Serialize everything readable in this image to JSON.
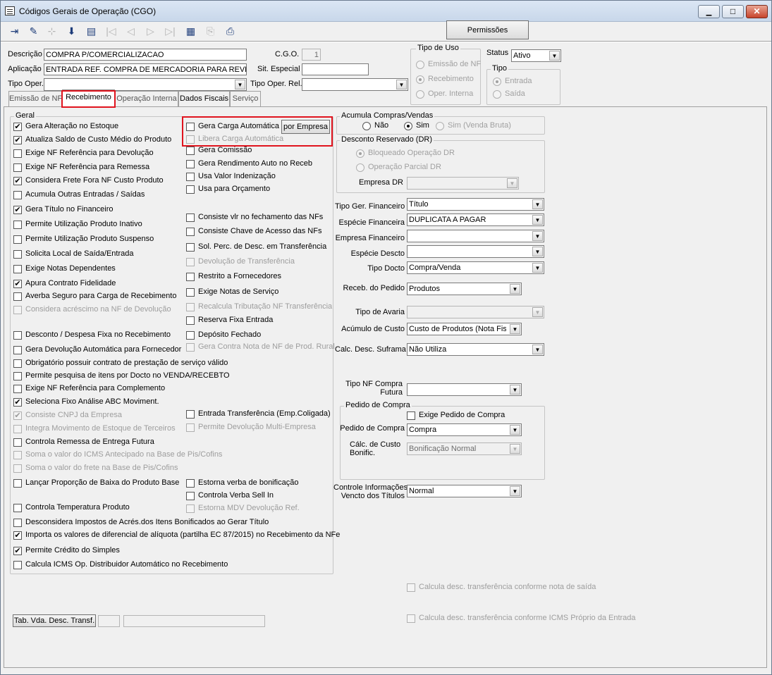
{
  "window": {
    "title": "Códigos Gerais de Operação (CGO)",
    "min": "▭",
    "max": "□",
    "close": "✕"
  },
  "toolbar": {
    "permissoes": "Permissões"
  },
  "header": {
    "descricao_label": "Descrição",
    "descricao_value": "COMPRA P/COMERCIALIZACAO",
    "aplicacao_label": "Aplicação",
    "aplicacao_value": "ENTRADA REF. COMPRA DE MERCADORIA PARA REVE",
    "tipo_oper_label": "Tipo Oper.",
    "tipo_oper_value": "",
    "cgo_label": "C.G.O.",
    "cgo_value": "1",
    "sit_especial_label": "Sit. Especial",
    "sit_especial_value": "",
    "tipo_oper_rel_label": "Tipo Oper. Rel.",
    "tipo_oper_rel_value": "",
    "tipo_uso_title": "Tipo de Uso",
    "tipo_uso_options": [
      "Emissão de NF",
      "Recebimento",
      "Oper. Interna"
    ],
    "status_label": "Status",
    "status_value": "Ativo",
    "tipo_title": "Tipo",
    "tipo_options": [
      "Entrada",
      "Saída"
    ]
  },
  "tabs": [
    "Emissão de NF",
    "Recebimento",
    "Operação Interna",
    "Dados Fiscais",
    "Serviço"
  ],
  "geral": {
    "title": "Geral",
    "left": [
      {
        "label": "Gera Alteração no Estoque",
        "checked": true,
        "disabled": false
      },
      {
        "label": "Atualiza Saldo de Custo Médio do Produto",
        "checked": true,
        "disabled": false
      },
      {
        "label": "Exige NF Referência para Devolução",
        "checked": false,
        "disabled": false
      },
      {
        "label": "Exige NF Referência para Remessa",
        "checked": false,
        "disabled": false
      },
      {
        "label": "Considera Frete Fora NF Custo Produto",
        "checked": true,
        "disabled": false
      },
      {
        "label": "Acumula Outras Entradas / Saídas",
        "checked": false,
        "disabled": false
      },
      {
        "label": "Gera Título no Financeiro",
        "checked": true,
        "disabled": false
      },
      {
        "label": "Permite Utilização Produto Inativo",
        "checked": false,
        "disabled": false
      },
      {
        "label": "Permite Utilização Produto Suspenso",
        "checked": false,
        "disabled": false
      },
      {
        "label": "Solicita Local de Saída/Entrada",
        "checked": false,
        "disabled": false
      },
      {
        "label": "Exige Notas Dependentes",
        "checked": false,
        "disabled": false
      },
      {
        "label": "Apura Contrato Fidelidade",
        "checked": true,
        "disabled": false
      },
      {
        "label": "Averba Seguro para Carga de Recebimento",
        "checked": false,
        "disabled": false
      },
      {
        "label": "Considera acréscimo na NF de Devolução",
        "checked": false,
        "disabled": true
      },
      {
        "label": "Desconto / Despesa Fixa no Recebimento",
        "checked": false,
        "disabled": false
      },
      {
        "label": "Gera Devolução Automática para Fornecedor",
        "checked": false,
        "disabled": false
      },
      {
        "label": "Obrigatório possuir contrato de prestação de serviço válido",
        "checked": false,
        "disabled": false
      },
      {
        "label": "Permite pesquisa de itens por Docto no VENDA/RECEBTO",
        "checked": false,
        "disabled": false
      },
      {
        "label": "Exige NF Referência para Complemento",
        "checked": false,
        "disabled": false
      },
      {
        "label": "Seleciona Fixo Análise ABC Moviment.",
        "checked": true,
        "disabled": false
      },
      {
        "label": "Consiste CNPJ da Empresa",
        "checked": true,
        "disabled": true
      },
      {
        "label": "Integra Movimento de Estoque de Terceiros",
        "checked": false,
        "disabled": true
      },
      {
        "label": "Controla Remessa de Entrega Futura",
        "checked": false,
        "disabled": false
      },
      {
        "label": "Soma o valor do ICMS Antecipado na Base de Pis/Cofins",
        "checked": false,
        "disabled": true
      },
      {
        "label": "Soma o valor do frete na Base de Pis/Cofins",
        "checked": false,
        "disabled": true
      },
      {
        "label": "Lançar Proporção de Baixa do Produto Base",
        "checked": false,
        "disabled": false
      },
      {
        "label": "Controla Temperatura Produto",
        "checked": false,
        "disabled": false
      },
      {
        "label": "Desconsidera Impostos de Acrés.dos Itens Bonificados ao Gerar Título",
        "checked": false,
        "disabled": false
      },
      {
        "label": "Importa os valores de diferencial de alíquota (partilha EC 87/2015) no Recebimento da NFe",
        "checked": true,
        "disabled": false
      },
      {
        "label": "Permite Crédito do Simples",
        "checked": true,
        "disabled": false
      },
      {
        "label": "Calcula ICMS Op. Distribuidor Automático no Recebimento",
        "checked": false,
        "disabled": false
      }
    ],
    "right": [
      {
        "label": "Gera Carga Automática",
        "checked": false,
        "disabled": false
      },
      {
        "label": "Libera Carga Automática",
        "checked": false,
        "disabled": true
      },
      {
        "label": "Gera Comissão",
        "checked": false,
        "disabled": false
      },
      {
        "label": "Gera Rendimento Auto no Receb",
        "checked": false,
        "disabled": false
      },
      {
        "label": "Usa Valor Indenização",
        "checked": false,
        "disabled": false
      },
      {
        "label": "Usa para Orçamento",
        "checked": false,
        "disabled": false
      },
      {
        "label": "Consiste vlr no fechamento das NFs",
        "checked": false,
        "disabled": false
      },
      {
        "label": "Consiste Chave de Acesso das NFs",
        "checked": false,
        "disabled": false
      },
      {
        "label": "Sol. Perc. de Desc. em Transferência",
        "checked": false,
        "disabled": false
      },
      {
        "label": "Devolução de Transferência",
        "checked": false,
        "disabled": true
      },
      {
        "label": "Restrito a Fornecedores",
        "checked": false,
        "disabled": false
      },
      {
        "label": "Exige Notas de Serviço",
        "checked": false,
        "disabled": false
      },
      {
        "label": "Recalcula Tributação NF Transferência",
        "checked": false,
        "disabled": true
      },
      {
        "label": "Reserva Fixa Entrada",
        "checked": false,
        "disabled": false
      },
      {
        "label": "Depósito Fechado",
        "checked": false,
        "disabled": false
      },
      {
        "label": "Gera Contra Nota de NF de Prod. Rural",
        "checked": false,
        "disabled": true
      },
      {
        "label": "Entrada Transferência (Emp.Coligada)",
        "checked": false,
        "disabled": false
      },
      {
        "label": "Permite Devolução Multi-Empresa",
        "checked": false,
        "disabled": true
      },
      {
        "label": "Estorna verba de bonificação",
        "checked": false,
        "disabled": false
      },
      {
        "label": "Controla Verba Sell In",
        "checked": false,
        "disabled": false
      },
      {
        "label": "Estorna MDV Devolução Ref.",
        "checked": false,
        "disabled": true
      }
    ],
    "por_empresa": "por Empresa"
  },
  "acumula": {
    "title": "Acumula Compras/Vendas",
    "options": [
      "Não",
      "Sim",
      "Sim (Venda Bruta)"
    ]
  },
  "desconto": {
    "title": "Desconto Reservado (DR)",
    "options": [
      "Bloqueado Operação DR",
      "Operação Parcial DR"
    ],
    "empresa_label": "Empresa DR",
    "empresa_value": ""
  },
  "fin": [
    {
      "label": "Tipo Ger. Financeiro",
      "value": "Título"
    },
    {
      "label": "Espécie Financeira",
      "value": "DUPLICATA A PAGAR"
    },
    {
      "label": "Empresa Financeiro",
      "value": ""
    },
    {
      "label": "Espécie Descto",
      "value": ""
    },
    {
      "label": "Tipo Docto",
      "value": "Compra/Venda"
    },
    {
      "label": "Receb. do Pedido",
      "value": "Produtos"
    },
    {
      "label": "Tipo de Avaria",
      "value": ""
    },
    {
      "label": "Acúmulo de Custo",
      "value": "Custo de Produtos (Nota Fiscal)"
    },
    {
      "label": "Calc. Desc. Suframa",
      "value": "Não Utiliza"
    },
    {
      "label1": "Tipo NF Compra",
      "label2": "Futura",
      "value": ""
    }
  ],
  "pedido": {
    "title": "Pedido de Compra",
    "exige": "Exige Pedido de Compra",
    "pedido_label": "Pedido de Compra",
    "pedido_value": "Compra",
    "calc_label1": "Cálc. de Custo",
    "calc_label2": "Bonific.",
    "calc_value": "Bonificação Normal"
  },
  "controle": {
    "label1": "Controle Informações",
    "label2": "Vencto dos Títulos",
    "value": "Normal"
  },
  "bottom": {
    "calcula1": "Calcula desc. transferência conforme nota de saída",
    "calcula2": "Calcula desc. transferência conforme ICMS Próprio da Entrada",
    "tab_vda": "Tab. Vda. Desc. Transf."
  }
}
